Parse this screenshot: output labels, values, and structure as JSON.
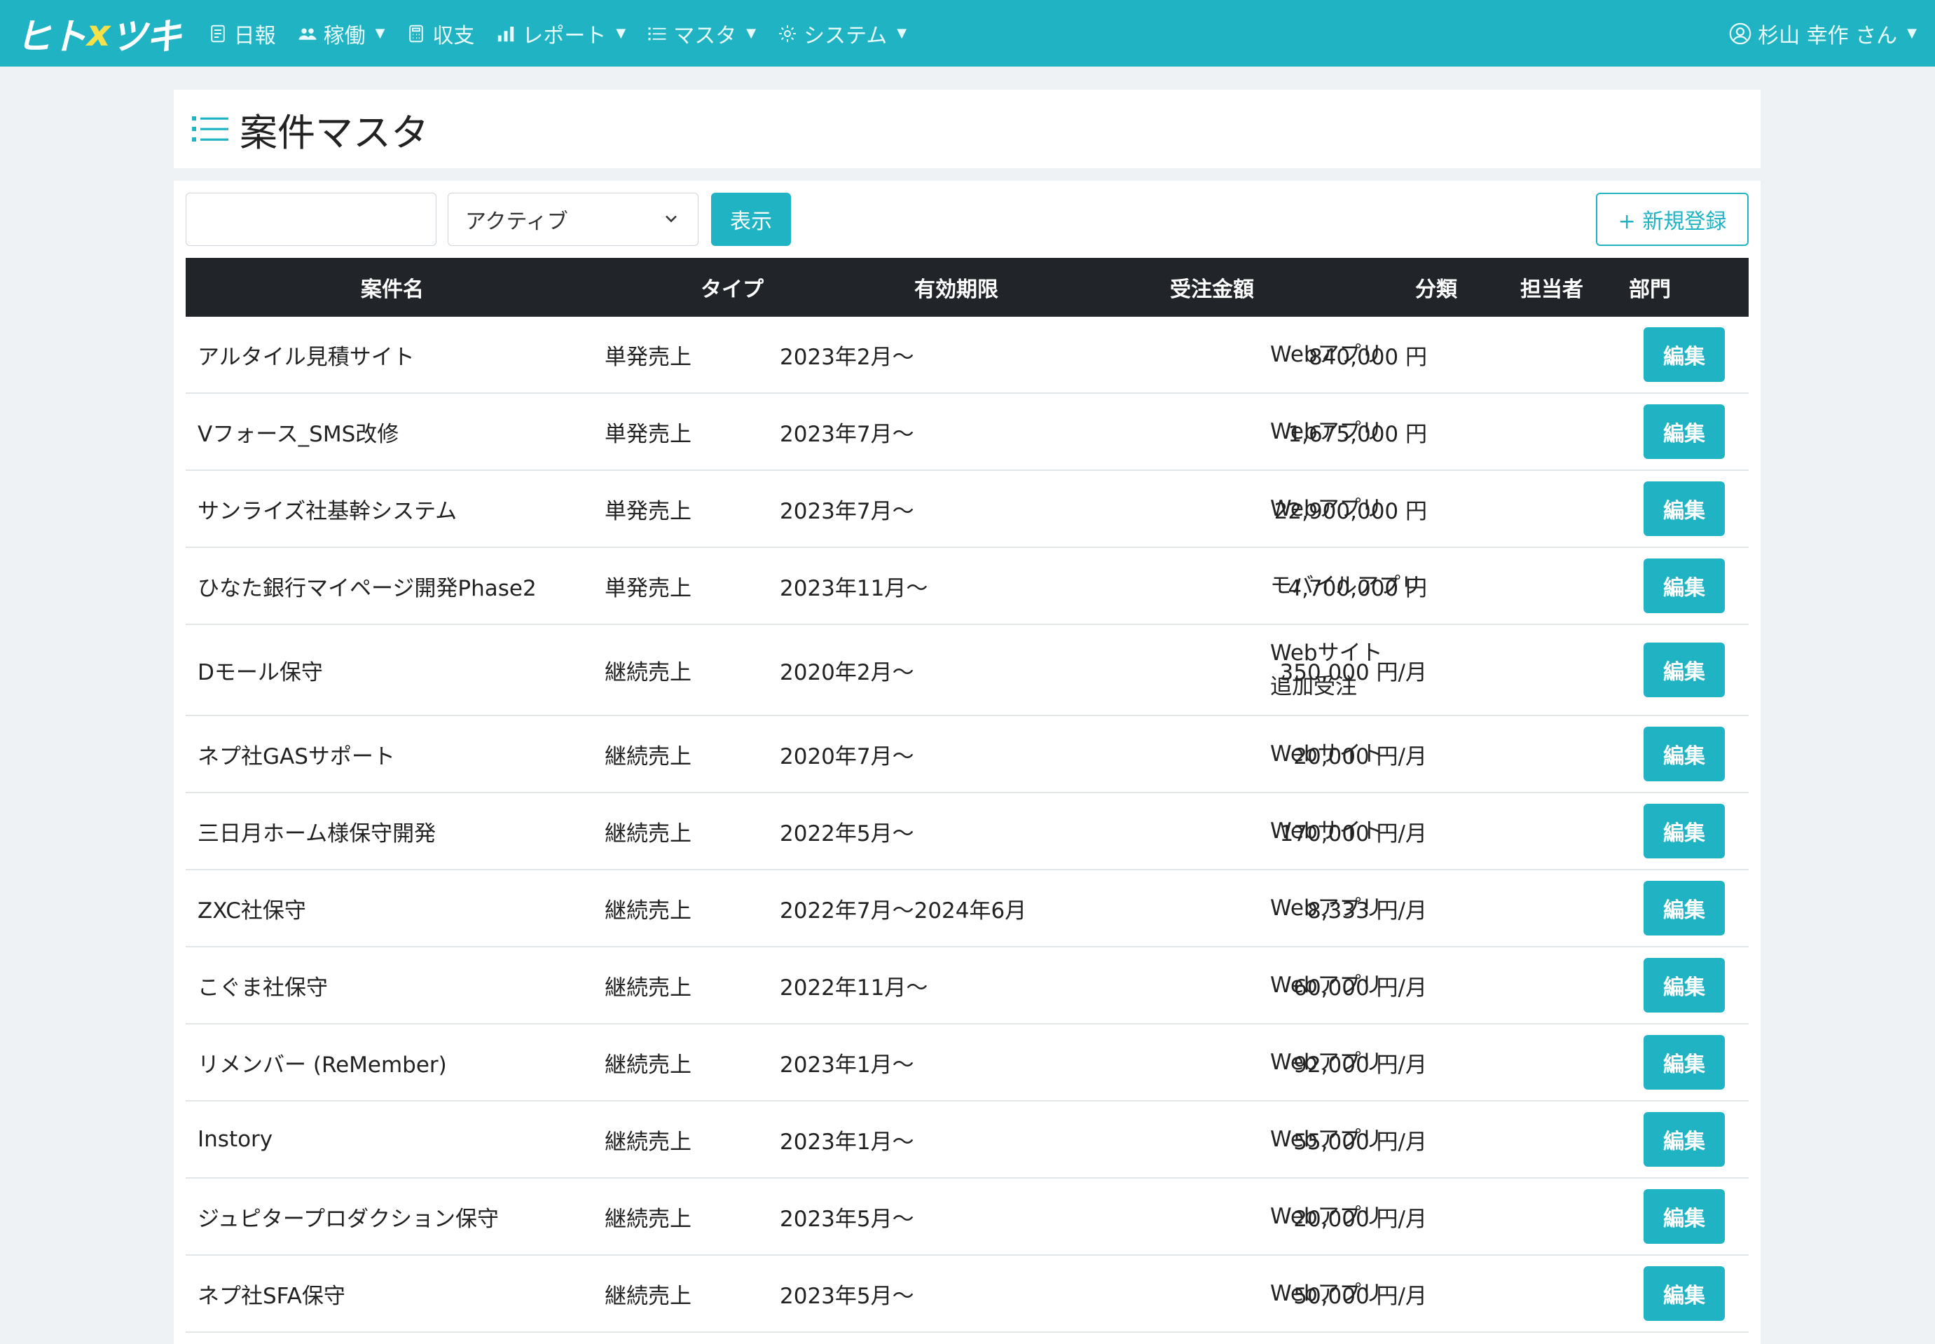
{
  "nav": {
    "logo_left": "ヒト",
    "logo_x": "x",
    "logo_right": "ツキ",
    "items": [
      {
        "label": "日報",
        "icon": "journal-icon",
        "dropdown": false
      },
      {
        "label": "稼働",
        "icon": "people-icon",
        "dropdown": true
      },
      {
        "label": "収支",
        "icon": "calculator-icon",
        "dropdown": false
      },
      {
        "label": "レポート",
        "icon": "bar-chart-icon",
        "dropdown": true
      },
      {
        "label": "マスタ",
        "icon": "list-icon",
        "dropdown": true
      },
      {
        "label": "システム",
        "icon": "gear-icon",
        "dropdown": true
      }
    ],
    "user": "杉山 幸作 さん"
  },
  "page": {
    "title": "案件マスタ"
  },
  "toolbar": {
    "search_value": "",
    "status_selected": "アクティブ",
    "show_label": "表示",
    "new_label": "+ 新規登録"
  },
  "table": {
    "headers": {
      "name": "案件名",
      "type": "タイプ",
      "period": "有効期限",
      "amount": "受注金額",
      "category": "分類",
      "owner": "担当者",
      "dept": "部門"
    },
    "edit_label": "編集",
    "rows": [
      {
        "name": "アルタイル見積サイト",
        "type": "単発売上",
        "period": "2023年2月〜",
        "amount": "840,000 円",
        "category": "Webアプリ",
        "category2": ""
      },
      {
        "name": "Vフォース_SMS改修",
        "type": "単発売上",
        "period": "2023年7月〜",
        "amount": "1,675,000 円",
        "category": "Webアプリ",
        "category2": ""
      },
      {
        "name": "サンライズ社基幹システム",
        "type": "単発売上",
        "period": "2023年7月〜",
        "amount": "22,900,000 円",
        "category": "Webアプリ",
        "category2": ""
      },
      {
        "name": "ひなた銀行マイページ開発Phase2",
        "type": "単発売上",
        "period": "2023年11月〜",
        "amount": "4,700,000 円",
        "category": "モバイルアプリ",
        "category2": ""
      },
      {
        "name": "Dモール保守",
        "type": "継続売上",
        "period": "2020年2月〜",
        "amount": "350,000 円/月",
        "category": "Webサイト",
        "category2": "追加受注"
      },
      {
        "name": "ネプ社GASサポート",
        "type": "継続売上",
        "period": "2020年7月〜",
        "amount": "20,000 円/月",
        "category": "Webサイト",
        "category2": ""
      },
      {
        "name": "三日月ホーム様保守開発",
        "type": "継続売上",
        "period": "2022年5月〜",
        "amount": "170,000 円/月",
        "category": "Webサイト",
        "category2": ""
      },
      {
        "name": "ZXC社保守",
        "type": "継続売上",
        "period": "2022年7月〜2024年6月",
        "amount": "8,333 円/月",
        "category": "Webアプリ",
        "category2": ""
      },
      {
        "name": "こぐま社保守",
        "type": "継続売上",
        "period": "2022年11月〜",
        "amount": "60,000 円/月",
        "category": "Webアプリ",
        "category2": ""
      },
      {
        "name": "リメンバー (ReMember)",
        "type": "継続売上",
        "period": "2023年1月〜",
        "amount": "92,000 円/月",
        "category": "Webアプリ",
        "category2": ""
      },
      {
        "name": "Instory",
        "type": "継続売上",
        "period": "2023年1月〜",
        "amount": "55,000 円/月",
        "category": "Webアプリ",
        "category2": ""
      },
      {
        "name": "ジュピタープロダクション保守",
        "type": "継続売上",
        "period": "2023年5月〜",
        "amount": "20,000 円/月",
        "category": "Webアプリ",
        "category2": ""
      },
      {
        "name": "ネプ社SFA保守",
        "type": "継続売上",
        "period": "2023年5月〜",
        "amount": "50,000 円/月",
        "category": "Webアプリ",
        "category2": ""
      }
    ]
  },
  "colors": {
    "accent": "#1fb3c4",
    "header_dark": "#212529",
    "background": "#eef2f5"
  }
}
